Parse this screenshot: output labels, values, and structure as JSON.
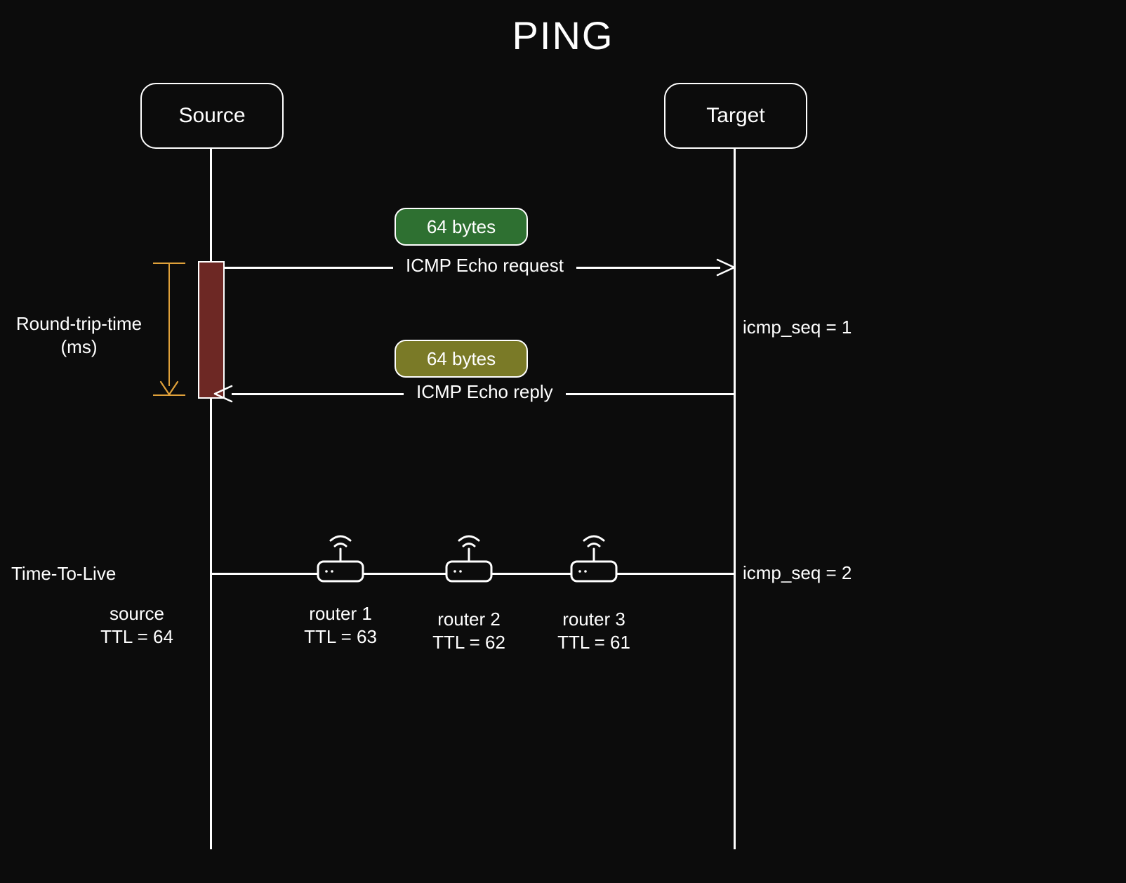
{
  "title": "PING",
  "nodes": {
    "source": "Source",
    "target": "Target"
  },
  "packets": {
    "request_bytes": "64 bytes",
    "reply_bytes": "64 bytes"
  },
  "messages": {
    "request": "ICMP Echo request",
    "reply": "ICMP Echo reply"
  },
  "left_labels": {
    "rtt_line1": "Round-trip-time",
    "rtt_line2": "(ms)",
    "ttl": "Time-To-Live"
  },
  "right_labels": {
    "seq1": "icmp_seq = 1",
    "seq2": "icmp_seq = 2"
  },
  "ttl": {
    "source_name": "source",
    "source_val": "TTL = 64",
    "r1_name": "router 1",
    "r1_val": "TTL = 63",
    "r2_name": "router 2",
    "r2_val": "TTL = 62",
    "r3_name": "router 3",
    "r3_val": "TTL = 61"
  },
  "colors": {
    "bg": "#0c0c0c",
    "stroke": "#ffffff",
    "rtt_bar": "#6d2824",
    "bracket": "#e0a13a",
    "pill_green": "#2e7031",
    "pill_olive": "#7a7a27"
  }
}
